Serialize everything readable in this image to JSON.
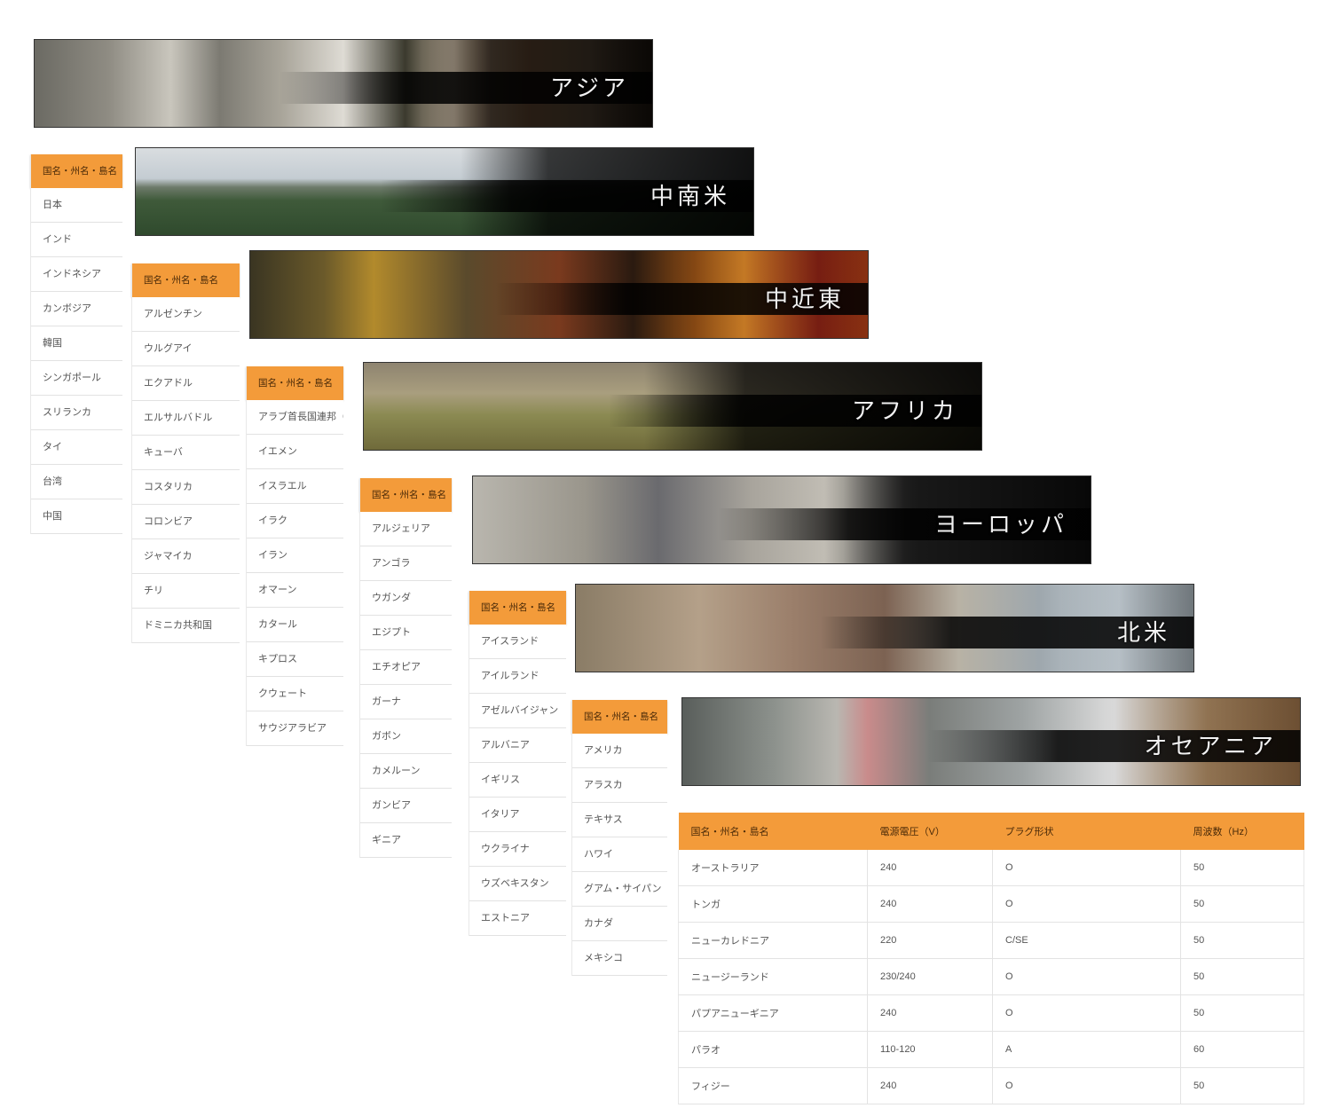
{
  "regions": [
    {
      "name": "アジア",
      "header": "国名・州名・島名",
      "items": [
        "日本",
        "インド",
        "インドネシア",
        "カンボジア",
        "韓国",
        "シンガポール",
        "スリランカ",
        "タイ",
        "台湾",
        "中国"
      ]
    },
    {
      "name": "中南米",
      "header": "国名・州名・島名",
      "items": [
        "アルゼンチン",
        "ウルグアイ",
        "エクアドル",
        "エルサルバドル",
        "キューバ",
        "コスタリカ",
        "コロンビア",
        "ジャマイカ",
        "チリ",
        "ドミニカ共和国"
      ]
    },
    {
      "name": "中近東",
      "header": "国名・州名・島名",
      "items": [
        "アラブ首長国連邦（I",
        "イエメン",
        "イスラエル",
        "イラク",
        "イラン",
        "オマーン",
        "カタール",
        "キプロス",
        "クウェート",
        "サウジアラビア"
      ]
    },
    {
      "name": "アフリカ",
      "header": "国名・州名・島名",
      "items": [
        "アルジェリア",
        "アンゴラ",
        "ウガンダ",
        "エジプト",
        "エチオピア",
        "ガーナ",
        "ガボン",
        "カメルーン",
        "ガンビア",
        "ギニア"
      ]
    },
    {
      "name": "ヨーロッパ",
      "header": "国名・州名・島名",
      "items": [
        "アイスランド",
        "アイルランド",
        "アゼルバイジャン",
        "アルバニア",
        "イギリス",
        "イタリア",
        "ウクライナ",
        "ウズベキスタン",
        "エストニア"
      ]
    },
    {
      "name": "北米",
      "header": "国名・州名・島名",
      "items": [
        "アメリカ",
        "アラスカ",
        "テキサス",
        "ハワイ",
        "グアム・サイパン",
        "カナダ",
        "メキシコ"
      ]
    },
    {
      "name": "オセアニア"
    }
  ],
  "oceania_table": {
    "headers": [
      "国名・州名・島名",
      "電源電圧（V）",
      "プラグ形状",
      "周波数（Hz）"
    ],
    "rows": [
      [
        "オーストラリア",
        "240",
        "O",
        "50"
      ],
      [
        "トンガ",
        "240",
        "O",
        "50"
      ],
      [
        "ニューカレドニア",
        "220",
        "C/SE",
        "50"
      ],
      [
        "ニュージーランド",
        "230/240",
        "O",
        "50"
      ],
      [
        "パプアニューギニア",
        "240",
        "O",
        "50"
      ],
      [
        "パラオ",
        "110-120",
        "A",
        "60"
      ],
      [
        "フィジー",
        "240",
        "O",
        "50"
      ]
    ]
  },
  "colors": {
    "accent": "#f39b3a"
  }
}
